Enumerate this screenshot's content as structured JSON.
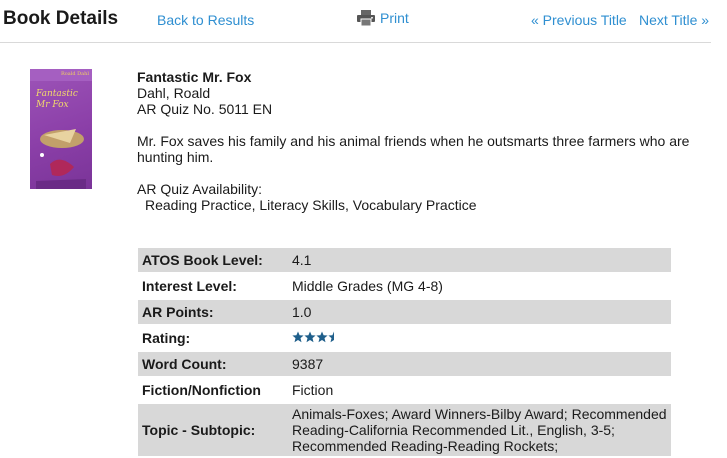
{
  "header": {
    "title": "Book Details",
    "back_label": "Back to Results",
    "print_label": "Print",
    "prev_label": "« Previous Title",
    "next_label": "Next Title »"
  },
  "cover": {
    "author_text": "Roald Dahl",
    "title_text": "Fantastic Mr Fox"
  },
  "book": {
    "title": "Fantastic Mr. Fox",
    "author": "Dahl, Roald",
    "quiz": "AR Quiz No. 5011 EN",
    "summary": "Mr. Fox saves his family and his animal friends when he outsmarts three farmers who are hunting him.",
    "availability_heading": "AR Quiz Availability:",
    "availability": "Reading Practice, Literacy Skills, Vocabulary Practice"
  },
  "details": [
    {
      "key": "ATOS Book Level:",
      "value": "4.1"
    },
    {
      "key": "Interest Level:",
      "value": "Middle Grades (MG 4-8)"
    },
    {
      "key": "AR Points:",
      "value": "1.0"
    },
    {
      "key": "Rating:",
      "value": ""
    },
    {
      "key": "Word Count:",
      "value": "9387"
    },
    {
      "key": "Fiction/Nonfiction",
      "value": "Fiction"
    },
    {
      "key": "Topic - Subtopic:",
      "value": "Animals-Foxes; Award Winners-Bilby Award; Recommended Reading-California Recommended Lit., English, 3-5; Recommended Reading-Reading Rockets;"
    }
  ],
  "rating": {
    "stars": 3.5,
    "max": 4,
    "color": "#1f5f8b"
  },
  "colors": {
    "link": "#2f8fd1",
    "row_shade": "#d8d8d8"
  }
}
